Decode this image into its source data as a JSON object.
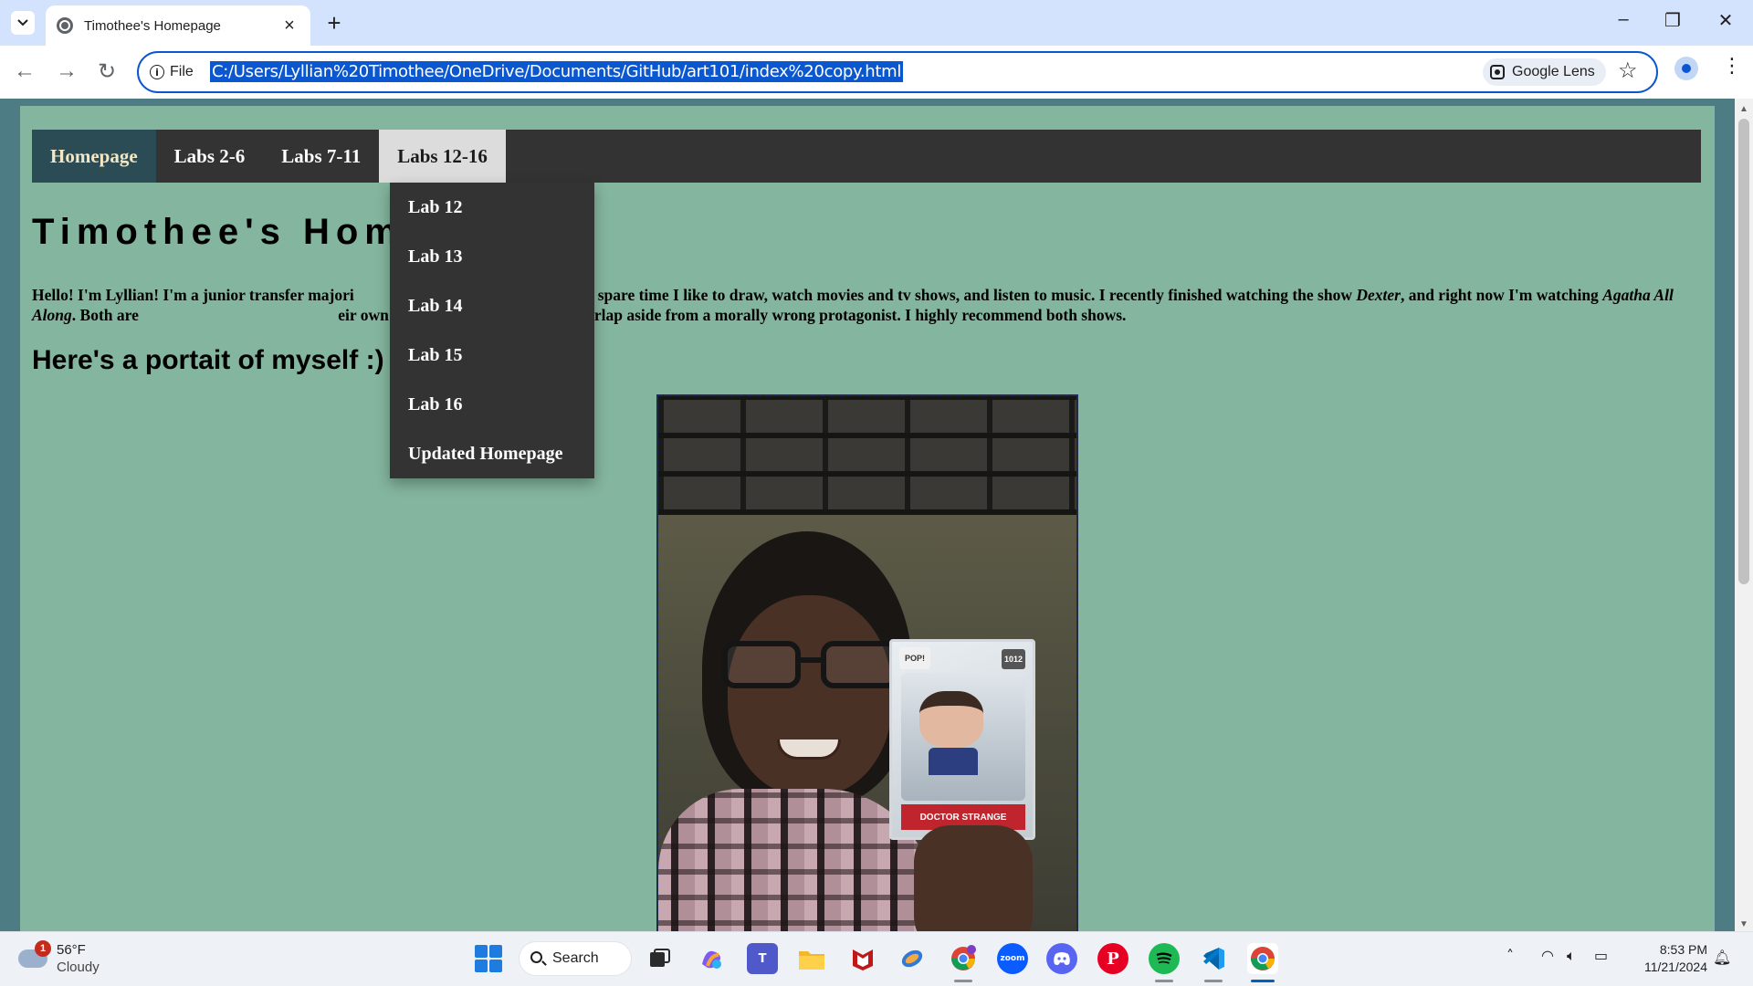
{
  "browser": {
    "tab_title": "Timothee's Homepage",
    "new_tab_label": "+",
    "site_info_label": "File",
    "url": "C:/Users/Lyllian%20Timothee/OneDrive/Documents/GitHub/art101/index%20copy.html",
    "lens_label": "Google Lens"
  },
  "page": {
    "nav": {
      "items": [
        "Homepage",
        "Labs 2-6",
        "Labs 7-11",
        "Labs 12-16"
      ],
      "active": "Homepage",
      "open_menu": "Labs 12-16"
    },
    "dropdown": [
      "Lab 12",
      "Lab 13",
      "Lab 14",
      "Lab 15",
      "Lab 16",
      "Updated Homepage"
    ],
    "title": "Timothee's Hom",
    "intro": {
      "part1": "Hello! I'm Lyllian! I'm a junior transfer majori",
      "part2": "ia. In my spare time I like to draw, watch movies and tv shows, and listen to music. I recently finished watching the show ",
      "show1": "Dexter",
      "part3": ", and right now I'm watching ",
      "show2": "Agatha All Along",
      "part4": ". Both are ",
      "part5": "eir own right, with not very much overlap aside from a morally wrong protagonist. I highly recommend both shows."
    },
    "subheading": "Here's a portait of myself :)",
    "portrait": {
      "figure_label": "DOCTOR STRANGE",
      "figure_number": "1012",
      "brand": "POP!"
    }
  },
  "taskbar": {
    "weather": {
      "temp": "56°F",
      "condition": "Cloudy",
      "badge": "1"
    },
    "search_label": "Search",
    "time": "8:53 PM",
    "date": "11/21/2024"
  },
  "colors": {
    "page_bg": "#84b59e",
    "navbar_bg": "#333333",
    "nav_active_bg": "#2b4c55",
    "accent": "#0b57d0"
  }
}
